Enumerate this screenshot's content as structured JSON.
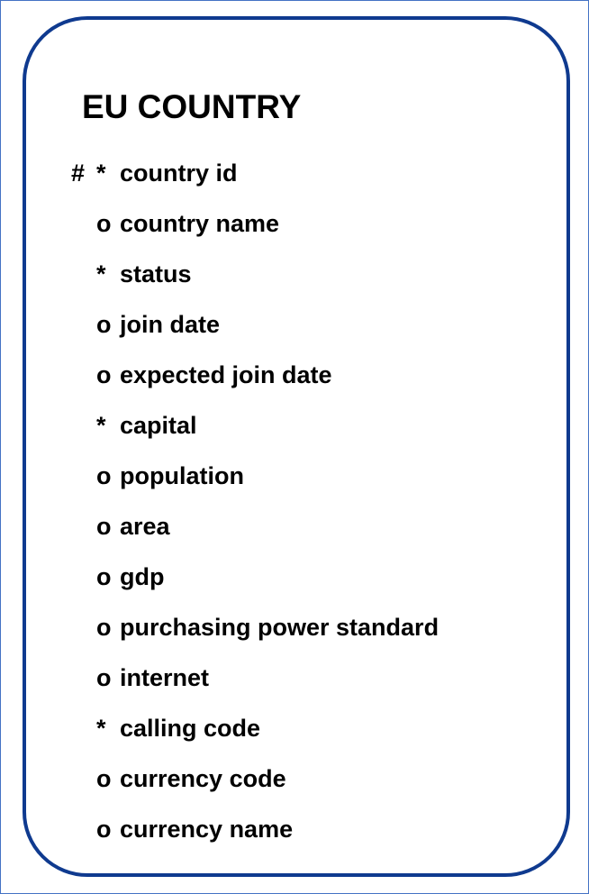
{
  "entity": {
    "title": "EU COUNTRY",
    "attributes": [
      {
        "unique": "#",
        "marker": "*",
        "name": "country id"
      },
      {
        "unique": "",
        "marker": "o",
        "name": "country name"
      },
      {
        "unique": "",
        "marker": "*",
        "name": "status"
      },
      {
        "unique": "",
        "marker": "o",
        "name": "join date"
      },
      {
        "unique": "",
        "marker": "o",
        "name": "expected join date"
      },
      {
        "unique": "",
        "marker": "*",
        "name": "capital"
      },
      {
        "unique": "",
        "marker": "o",
        "name": "population"
      },
      {
        "unique": "",
        "marker": "o",
        "name": "area"
      },
      {
        "unique": "",
        "marker": "o",
        "name": "gdp"
      },
      {
        "unique": "",
        "marker": "o",
        "name": "purchasing power standard"
      },
      {
        "unique": "",
        "marker": "o",
        "name": "internet"
      },
      {
        "unique": "",
        "marker": "*",
        "name": "calling code"
      },
      {
        "unique": "",
        "marker": "o",
        "name": "currency code"
      },
      {
        "unique": "",
        "marker": "o",
        "name": "currency name"
      }
    ]
  },
  "colors": {
    "entity_border": "#0f3a8f",
    "frame_border": "#4472c4",
    "text": "#000000"
  }
}
